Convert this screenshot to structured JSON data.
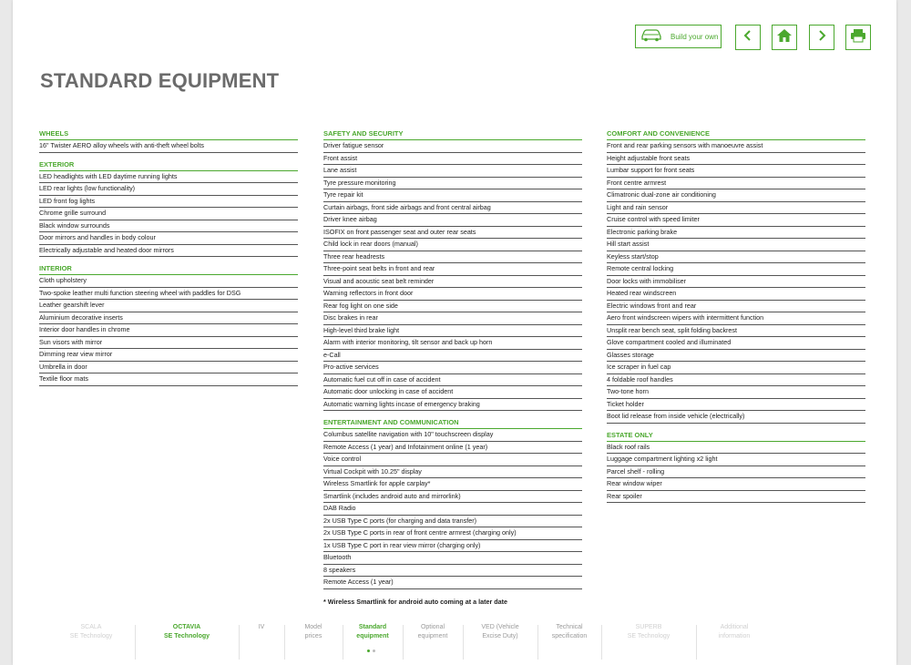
{
  "page_title": "STANDARD EQUIPMENT",
  "toolbar": {
    "build_label": "Build your own",
    "accent": "#4ba82e"
  },
  "col1": {
    "wheels": {
      "heading": "WHEELS",
      "items": [
        "16\" Twister AERO alloy wheels with anti-theft wheel bolts"
      ]
    },
    "exterior": {
      "heading": "EXTERIOR",
      "items": [
        "LED headlights with LED daytime running lights",
        "LED rear lights (low functionality)",
        "LED front fog lights",
        "Chrome grille surround",
        "Black window surrounds",
        "Door mirrors and handles in body colour",
        "Electrically adjustable and heated door mirrors"
      ]
    },
    "interior": {
      "heading": "INTERIOR",
      "items": [
        "Cloth upholstery",
        "Two-spoke leather multi function steering wheel with paddles for DSG",
        "Leather gearshift lever",
        "Aluminium decorative inserts",
        "Interior door handles in chrome",
        "Sun visors with mirror",
        "Dimming rear view mirror",
        "Umbrella in door",
        "Textile floor mats"
      ]
    }
  },
  "col2": {
    "safety": {
      "heading": "SAFETY AND SECURITY",
      "items": [
        "Driver fatigue sensor",
        "Front assist",
        "Lane assist",
        "Tyre pressure monitoring",
        "Tyre repair kit",
        "Curtain airbags, front side airbags and front central airbag",
        "Driver knee airbag",
        "ISOFIX on front passenger seat and outer rear seats",
        "Child lock in rear doors (manual)",
        "Three rear headrests",
        "Three-point seat belts in front and rear",
        "Visual and acoustic seat belt reminder",
        "Warning reflectors  in front door",
        "Rear fog light on one side",
        "Disc brakes in rear",
        "High-level third brake light",
        "Alarm with interior monitoring, tilt sensor and back up horn",
        "e-Call",
        "Pro-active services",
        "Automatic fuel cut off in case of accident",
        "Automatic door unlocking in case of accident",
        "Automatic warning lights incase of emergency braking"
      ]
    },
    "entertainment": {
      "heading": "ENTERTAINMENT AND COMMUNICATION",
      "items": [
        "Columbus satellite navigation with 10\" touchscreen display",
        "Remote Access (1 year) and Infotainment online (1 year)",
        "Voice control",
        "Virtual Cockpit with 10.25\" display",
        "Wireless Smartlink for apple carplay*",
        "Smartlink (includes android auto and mirrorlink)",
        "DAB Radio",
        "2x USB Type C ports (for charging and data transfer)",
        "2x USB Type C ports in rear of front centre armrest (charging only)",
        "1x USB Type C port in rear view mirror (charging only)",
        "Bluetooth",
        "8 speakers",
        "Remote Access (1 year)"
      ]
    },
    "footnote": "* Wireless Smartlink for android auto coming at a later date"
  },
  "col3": {
    "comfort": {
      "heading": "COMFORT AND CONVENIENCE",
      "items": [
        "Front and rear parking sensors with manoeuvre assist",
        "Height adjustable front seats",
        "Lumbar support for front seats",
        "Front centre armrest",
        "Climatronic dual-zone air conditioning",
        "Light and rain sensor",
        "Cruise control with speed limiter",
        "Electronic parking brake",
        "Hill start assist",
        "Keyless start/stop",
        "Remote central locking",
        "Door locks with immobiliser",
        "Heated rear windscreen",
        "Electric windows front and rear",
        "Aero front windscreen wipers with intermittent function",
        "Unsplit rear bench seat, split folding backrest",
        "Glove compartment cooled and illuminated",
        "Glasses storage",
        "Ice scraper in fuel cap",
        "4 foldable roof handles",
        "Two-tone horn",
        "Ticket holder",
        "Boot lid release from inside vehicle (electrically)"
      ]
    },
    "estate": {
      "heading": "ESTATE ONLY",
      "items": [
        "Black roof rails",
        "Luggage compartment lighting x2 light",
        "Parcel shelf - rolling",
        "Rear window wiper",
        "Rear spoiler"
      ]
    }
  },
  "bottom_nav": [
    {
      "l1": "SCALA",
      "l2": "SE Technology",
      "style": "faint"
    },
    {
      "l1": "OCTAVIA",
      "l2": "SE Technology",
      "style": "green"
    },
    {
      "l1": "IV",
      "l2": "",
      "style": "grey"
    },
    {
      "l1": "Model",
      "l2": "prices",
      "style": "grey"
    },
    {
      "l1": "Standard",
      "l2": "equipment",
      "style": "green"
    },
    {
      "l1": "Optional",
      "l2": "equipment",
      "style": "grey"
    },
    {
      "l1": "VED (Vehicle",
      "l2": "Excise Duty)",
      "style": "grey"
    },
    {
      "l1": "Technical",
      "l2": "specification",
      "style": "grey"
    },
    {
      "l1": "SUPERB",
      "l2": "SE Technology",
      "style": "faint"
    },
    {
      "l1": "Additional",
      "l2": "information",
      "style": "faint"
    }
  ]
}
